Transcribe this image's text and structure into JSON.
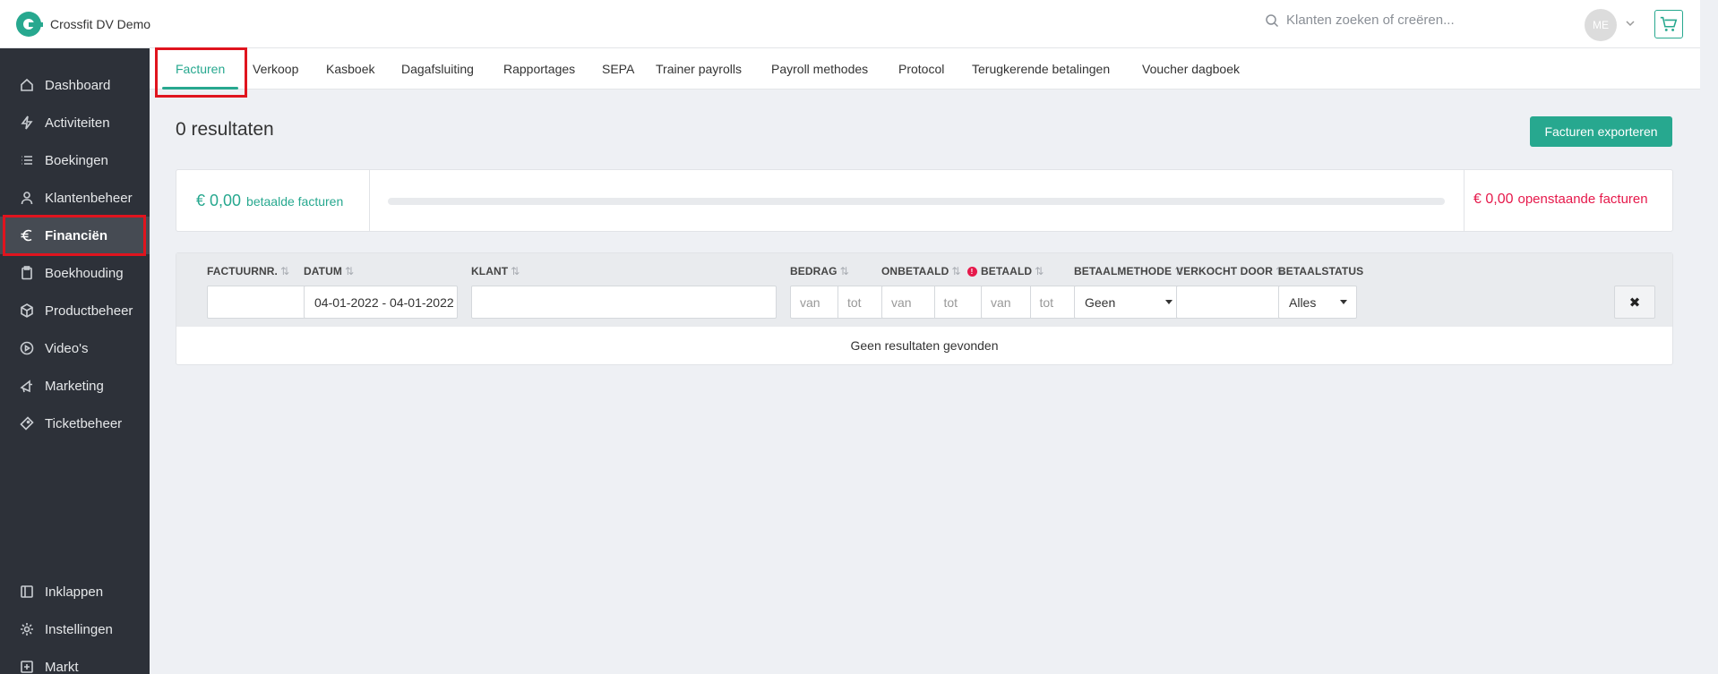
{
  "app": {
    "name": "Crossfit DV Demo"
  },
  "search": {
    "placeholder": "Klanten zoeken of creëren..."
  },
  "user": {
    "initials": "ME"
  },
  "sidebar": {
    "items": [
      {
        "label": "Dashboard",
        "icon": "home-icon"
      },
      {
        "label": "Activiteiten",
        "icon": "bolt-icon"
      },
      {
        "label": "Boekingen",
        "icon": "list-icon"
      },
      {
        "label": "Klantenbeheer",
        "icon": "user-icon"
      },
      {
        "label": "Financiën",
        "icon": "euro-icon",
        "active": true
      },
      {
        "label": "Boekhouding",
        "icon": "clipboard-icon"
      },
      {
        "label": "Productbeheer",
        "icon": "box-icon"
      },
      {
        "label": "Video's",
        "icon": "play-icon"
      },
      {
        "label": "Marketing",
        "icon": "megaphone-icon"
      },
      {
        "label": "Ticketbeheer",
        "icon": "ticket-icon"
      }
    ],
    "bottom": [
      {
        "label": "Inklappen",
        "icon": "collapse-icon"
      },
      {
        "label": "Instellingen",
        "icon": "gear-icon"
      },
      {
        "label": "Markt",
        "icon": "plus-square-icon"
      }
    ]
  },
  "tabs": [
    {
      "label": "Facturen",
      "active": true
    },
    {
      "label": "Verkoop"
    },
    {
      "label": "Kasboek"
    },
    {
      "label": "Dagafsluiting"
    },
    {
      "label": "Rapportages"
    },
    {
      "label": "SEPA"
    },
    {
      "label": "Trainer payrolls"
    },
    {
      "label": "Payroll methodes"
    },
    {
      "label": "Protocol"
    },
    {
      "label": "Terugkerende betalingen"
    },
    {
      "label": "Voucher dagboek"
    }
  ],
  "main": {
    "results": "0 resultaten",
    "export_label": "Facturen exporteren"
  },
  "summary": {
    "paid_amount": "€ 0,00",
    "paid_label": "betaalde facturen",
    "paid_fraction": 0,
    "open_amount": "€ 0,00",
    "open_label": "openstaande facturen"
  },
  "table": {
    "columns": {
      "invoice_nr": "FACTUURNR.",
      "date": "DATUM",
      "client": "KLANT",
      "amount": "BEDRAG",
      "unpaid": "ONBETAALD",
      "paid": "BETAALD",
      "method": "BETAALMETHODE",
      "sold_by": "VERKOCHT DOOR",
      "status": "BETAALSTATUS"
    },
    "filters": {
      "invoice_nr": "",
      "date": "04-01-2022 - 04-01-2022",
      "client": "",
      "range_from": "van",
      "range_to": "tot",
      "method": "Geen",
      "sold_by": "",
      "status": "Alles",
      "clear": "✖"
    },
    "empty": "Geen resultaten gevonden"
  },
  "colors": {
    "accent": "#27a88f",
    "danger": "#e6194b",
    "sidebar": "#2d3139",
    "highlight": "#e0141e"
  }
}
